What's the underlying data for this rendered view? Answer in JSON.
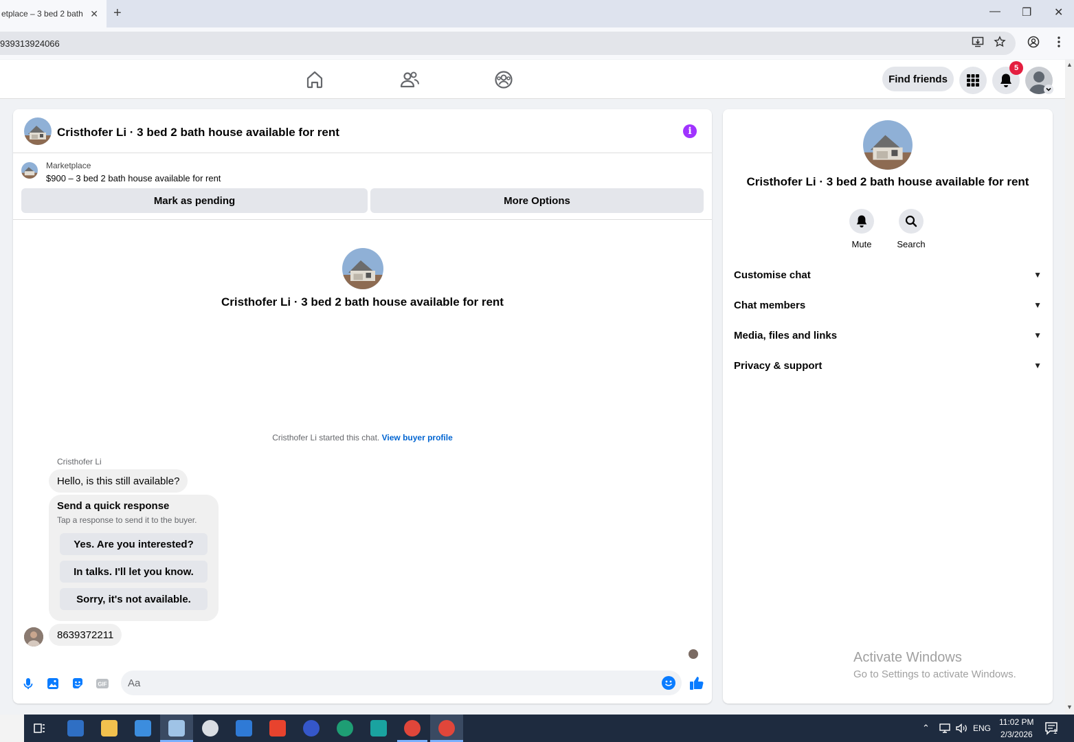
{
  "browser": {
    "tab_title": "etplace – 3 bed 2 bath",
    "tab_close": "✕",
    "new_tab": "+",
    "url": "939313924066",
    "win_min": "—",
    "win_restore": "❐",
    "win_close": "✕"
  },
  "nav": {
    "find_friends": "Find friends",
    "notification_count": "5"
  },
  "chat": {
    "header_title": "Cristhofer Li · 3 bed 2 bath house available for rent",
    "info_glyph": "i",
    "marketplace_label": "Marketplace",
    "listing": "$900 – 3 bed 2 bath house available for rent",
    "mark_pending": "Mark as pending",
    "more_options": "More Options",
    "center_title": "Cristhofer Li · 3 bed 2 bath house available for rent",
    "started_text": "Cristhofer Li started this chat.",
    "view_buyer_profile": "View buyer profile",
    "sender_name": "Cristhofer Li",
    "message_1": "Hello, is this still available?",
    "quick_title": "Send a quick response",
    "quick_sub": "Tap a response to send it to the buyer.",
    "quick_options": [
      "Yes. Are you interested?",
      "In talks. I'll let you know.",
      "Sorry, it's not available."
    ],
    "message_2": "8639372211",
    "composer_placeholder": "Aa"
  },
  "right": {
    "title": "Cristhofer Li · 3 bed 2 bath house available for rent",
    "mute": "Mute",
    "search": "Search",
    "sections": [
      "Customise chat",
      "Chat members",
      "Media, files and links",
      "Privacy & support"
    ]
  },
  "watermark": {
    "line1": "Activate Windows",
    "line2": "Go to Settings to activate Windows."
  },
  "taskbar": {
    "language": "ENG",
    "time": "11:02 PM",
    "date": "2/3/2026",
    "notif_count": "1"
  },
  "colors": {
    "accent_blue": "#0a7cff",
    "info_purple": "#a033ff",
    "badge_red": "#e41e3f"
  }
}
